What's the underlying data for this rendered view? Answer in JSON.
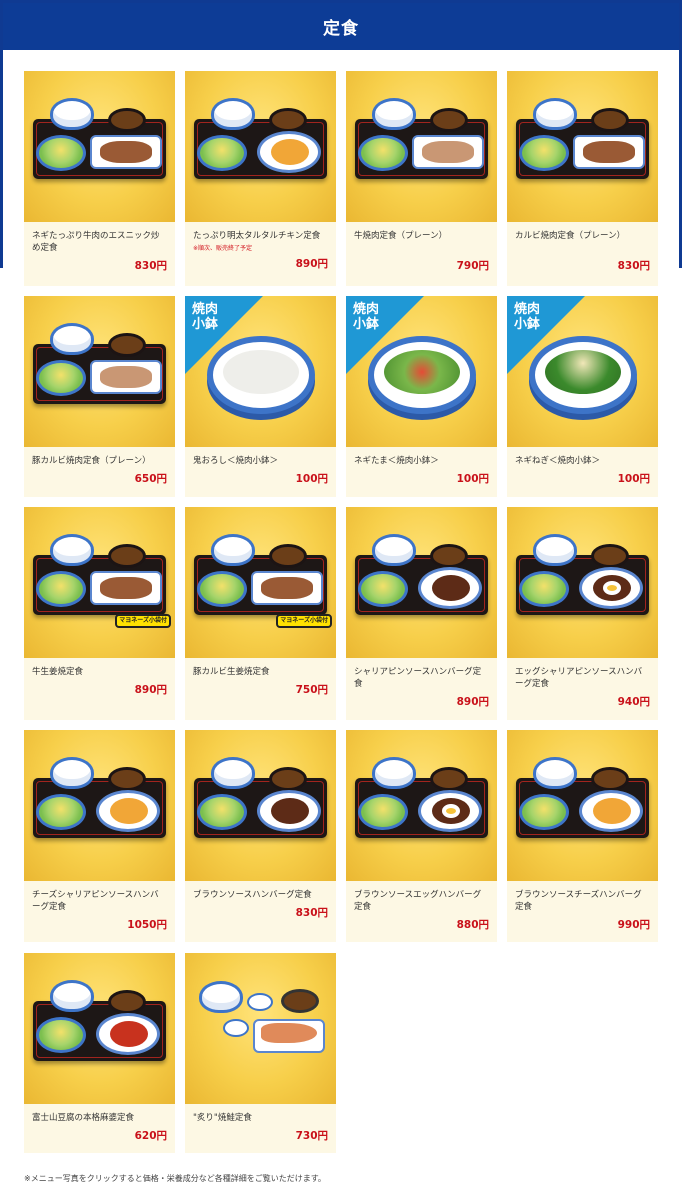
{
  "header": {
    "title": "定食"
  },
  "items": [
    {
      "name": "ネギたっぷり牛肉のエスニック炒め定食",
      "price": "830円",
      "note": ""
    },
    {
      "name": "たっぷり明太タルタルチキン定食",
      "price": "890円",
      "note": "※順次、販売終了予定"
    },
    {
      "name": "牛焼肉定食（プレーン）",
      "price": "790円",
      "note": ""
    },
    {
      "name": "カルビ焼肉定食（プレーン）",
      "price": "830円",
      "note": ""
    },
    {
      "name": "豚カルビ焼肉定食（プレーン）",
      "price": "650円",
      "note": ""
    },
    {
      "name": "鬼おろし＜焼肉小鉢＞",
      "price": "100円",
      "note": "",
      "badge": "焼肉小鉢"
    },
    {
      "name": "ネギたま＜焼肉小鉢＞",
      "price": "100円",
      "note": "",
      "badge": "焼肉小鉢"
    },
    {
      "name": "ネギねぎ＜焼肉小鉢＞",
      "price": "100円",
      "note": "",
      "badge": "焼肉小鉢"
    },
    {
      "name": "牛生姜焼定食",
      "price": "890円",
      "note": "",
      "tag": "マヨネーズ小袋付"
    },
    {
      "name": "豚カルビ生姜焼定食",
      "price": "750円",
      "note": "",
      "tag": "マヨネーズ小袋付"
    },
    {
      "name": "シャリアピンソースハンバーグ定食",
      "price": "890円",
      "note": ""
    },
    {
      "name": "エッグシャリアピンソースハンバーグ定食",
      "price": "940円",
      "note": ""
    },
    {
      "name": "チーズシャリアピンソースハンバーグ定食",
      "price": "1050円",
      "note": ""
    },
    {
      "name": "ブラウンソースハンバーグ定食",
      "price": "830円",
      "note": ""
    },
    {
      "name": "ブラウンソースエッグハンバーグ定食",
      "price": "880円",
      "note": ""
    },
    {
      "name": "ブラウンソースチーズハンバーグ定食",
      "price": "990円",
      "note": ""
    },
    {
      "name": "富士山豆腐の本格麻婆定食",
      "price": "620円",
      "note": ""
    },
    {
      "name": "\"炙り\"焼鮭定食",
      "price": "730円",
      "note": ""
    }
  ],
  "footnote": "※メニュー写真をクリックすると価格・栄養成分など各種詳細をご覧いただけます。",
  "colors": {
    "header_bg": "#0d3c96",
    "price": "#c9111a",
    "card_bg": "#fdf8e4",
    "badge": "#1f98d5"
  }
}
